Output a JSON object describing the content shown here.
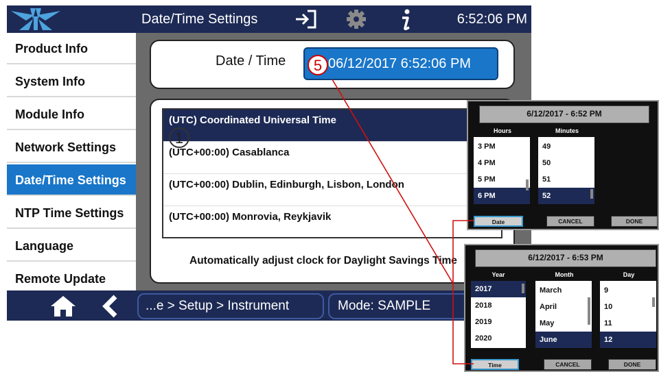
{
  "header": {
    "title": "Date/Time Settings",
    "clock": "6:52:06 PM",
    "icons": [
      "logo-icon",
      "exit-icon",
      "gear-icon",
      "info-icon"
    ]
  },
  "sidebar": {
    "items": [
      {
        "label": "Product Info"
      },
      {
        "label": "System Info"
      },
      {
        "label": "Module Info"
      },
      {
        "label": "Network Settings"
      },
      {
        "label": "Date/Time Settings",
        "active": true
      },
      {
        "label": "NTP Time Settings"
      },
      {
        "label": "Language"
      },
      {
        "label": "Remote Update"
      }
    ]
  },
  "main": {
    "datetime_label": "Date / Time",
    "datetime_value": "06/12/2017 6:52:06 PM",
    "timezones": [
      "(UTC) Coordinated Universal Time",
      "(UTC+00:00) Casablanca",
      "(UTC+00:00) Dublin, Edinburgh, Lisbon, London",
      "(UTC+00:00) Monrovia, Reykjavik"
    ],
    "dst_label": "Automatically adjust clock for Daylight Savings Time"
  },
  "footer": {
    "breadcrumb": "...e > Setup > Instrument",
    "mode": "Mode: SAMPLE"
  },
  "callouts": {
    "one": "1",
    "five": "5"
  },
  "time_popup": {
    "title": "6/12/2017 - 6:52 PM",
    "hours_header": "Hours",
    "minutes_header": "Minutes",
    "hours": [
      "3 PM",
      "4 PM",
      "5 PM",
      "6 PM"
    ],
    "minutes": [
      "49",
      "50",
      "51",
      "52"
    ],
    "buttons": {
      "date": "Date",
      "cancel": "CANCEL",
      "done": "DONE"
    }
  },
  "date_popup": {
    "title": "6/12/2017 - 6:53 PM",
    "year_header": "Year",
    "month_header": "Month",
    "day_header": "Day",
    "years": [
      "2017",
      "2018",
      "2019",
      "2020"
    ],
    "months": [
      "March",
      "April",
      "May",
      "June"
    ],
    "days": [
      "9",
      "10",
      "11",
      "12"
    ],
    "buttons": {
      "time": "Time",
      "cancel": "CANCEL",
      "done": "DONE"
    }
  },
  "colors": {
    "navy": "#1d2a55",
    "accent_blue": "#1976c9",
    "callout_red": "#c00000",
    "gray": "#6b6b6b"
  }
}
